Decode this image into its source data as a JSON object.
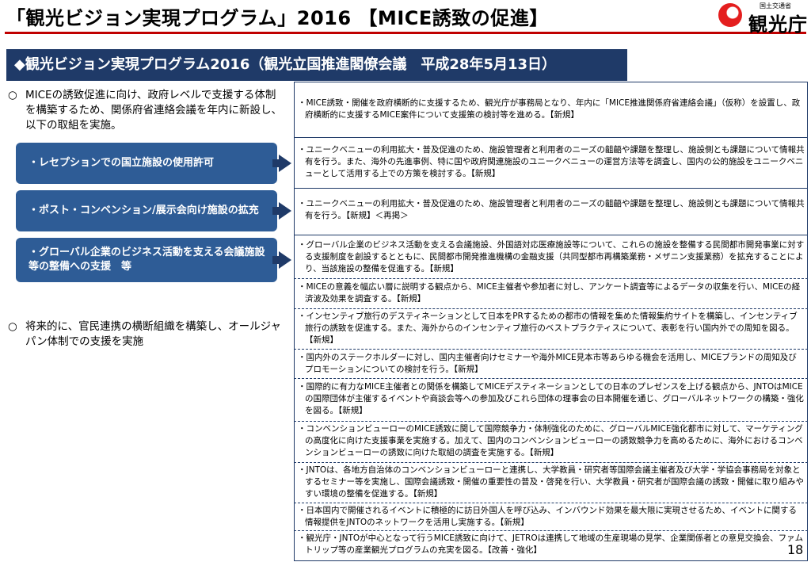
{
  "header": {
    "title": "「観光ビジョン実現プログラム」2016 【MICE誘致の促進】",
    "logo_small": "国土交通省",
    "logo_main": "観光庁"
  },
  "banner": "◆観光ビジョン実現プログラム2016（観光立国推進閣僚会議　平成28年5月13日）",
  "left": {
    "bullet1_mark": "○",
    "bullet1": "MICEの誘致促進に向け、政府レベルで支援する体制を構築するため、関係府省連絡会議を年内に新設し、以下の取組を実施。",
    "pills": [
      "・レセプションでの国立施設の使用許可",
      "・ポスト・コンベンション/展示会向け施設の拡充",
      "・グローバル企業のビジネス活動を支える会議施設等の整備への支援　等"
    ],
    "bullet2_mark": "○",
    "bullet2": "将来的に、官民連携の横断組織を構築し、オールジャパン体制での支援を実施"
  },
  "items": [
    "・MICE誘致・開催を政府横断的に支援するため、観光庁が事務局となり、年内に「MICE推進関係府省連絡会議」（仮称）を設置し、政府横断的に支援するMICE案件について支援策の検討等を進める。【新規】",
    "・ユニークベニューの利用拡大・普及促進のため、施設管理者と利用者のニーズの齟齬や課題を整理し、施設側とも課題について情報共有を行う。また、海外の先進事例、特に国や政府関連施設のユニークベニューの運営方法等を調査し、国内の公的施設をユニークベニューとして活用する上での方策を検討する。【新規】",
    "・ユニークベニューの利用拡大・普及促進のため、施設管理者と利用者のニーズの齟齬や課題を整理し、施設側とも課題について情報共有を行う。【新規】＜再掲＞",
    "・グローバル企業のビジネス活動を支える会議施設、外国語対応医療施設等について、これらの施設を整備する民間都市開発事業に対する支援制度を創設するとともに、民間都市開発推進機構の金融支援（共同型都市再構築業務・メザニン支援業務）を拡充することにより、当該施設の整備を促進する。【新規】",
    "・MICEの意義を幅広い層に説明する観点から、MICE主催者や参加者に対し、アンケート調査等によるデータの収集を行い、MICEの経済波及効果を調査する。【新規】",
    "・インセンティブ旅行のデスティネーションとして日本をPRするための都市の情報を集めた情報集約サイトを構築し、インセンティブ旅行の誘致を促進する。また、海外からのインセンティブ旅行のベストプラクティスについて、表彰を行い国内外での周知を図る。【新規】",
    "・国内外のステークホルダーに対し、国内主催者向けセミナーや海外MICE見本市等あらゆる機会を活用し、MICEブランドの周知及びプロモーションについての検討を行う。【新規】",
    "・国際的に有力なMICE主催者との関係を構築してMICEデスティネーションとしての日本のプレゼンスを上げる観点から、JNTOはMICEの国際団体が主催するイベントや商談会等への参加及びこれら団体の理事会の日本開催を通じ、グローバルネットワークの構築・強化を図る。【新規】",
    "・コンベンションビューローのMICE誘致に関して国際競争力・体制強化のために、グローバルMICE強化都市に対して、マーケティングの高度化に向けた支援事業を実施する。加えて、国内のコンベンションビューローの誘致競争力を高めるために、海外におけるコンベンションビューローの誘致に向けた取組の調査を実施する。【新規】",
    "・JNTOは、各地方自治体のコンベンションビューローと連携し、大学教員・研究者等国際会議主催者及び大学・学協会事務局を対象とするセミナー等を実施し、国際会議誘致・開催の重要性の普及・啓発を行い、大学教員・研究者が国際会議の誘致・開催に取り組みやすい環境の整備を促進する。【新規】",
    "・日本国内で開催されるイベントに積極的に訪日外国人を呼び込み、インバウンド効果を最大限に実現させるため、イベントに関する情報提供をJNTOのネットワークを活用し実施する。【新規】",
    "・観光庁・JNTOが中心となって行うMICE誘致に向けて、JETROは連携して地域の生産現場の見学、企業関係者との意見交換会、ファムトリップ等の産業観光プログラムの充実を図る。【改善・強化】"
  ],
  "page_number": "18",
  "colors": {
    "banner": "#1f3a68",
    "pill": "#2e5c96",
    "rule": "#c00000",
    "logo": "#e41e1e"
  }
}
